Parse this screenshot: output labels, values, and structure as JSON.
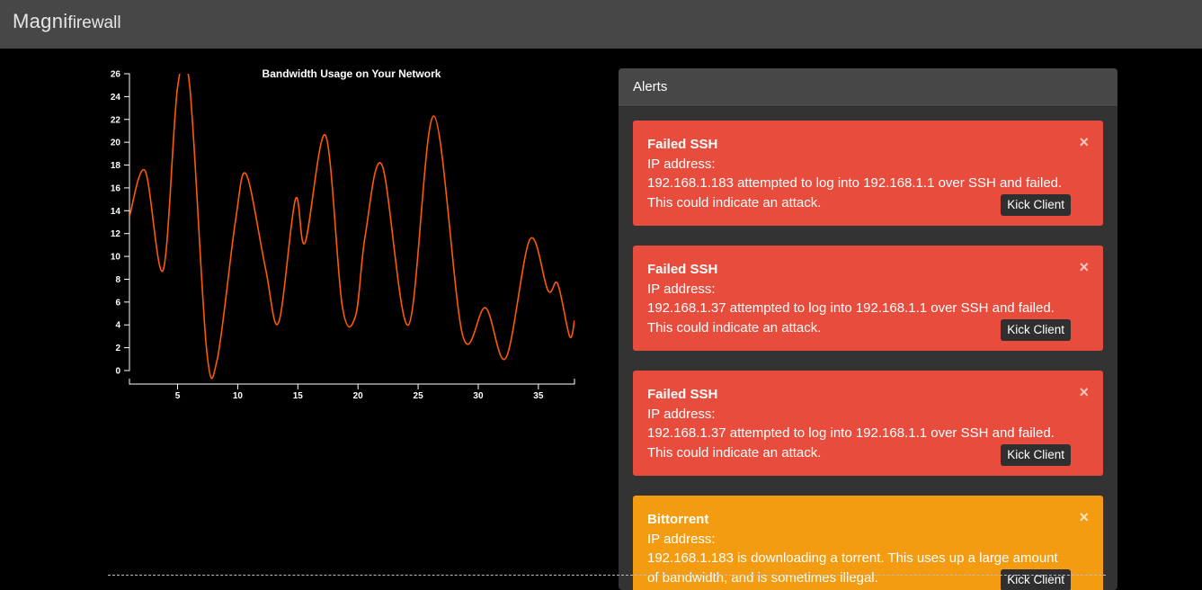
{
  "brand": {
    "part1": "Magni",
    "part2": "firewall"
  },
  "chart_data": {
    "type": "line",
    "title": "Bandwidth Usage on Your Network",
    "xlabel": "",
    "ylabel": "",
    "xlim": [
      1,
      38
    ],
    "ylim": [
      0,
      26
    ],
    "x_ticks": [
      5,
      10,
      15,
      20,
      25,
      30,
      35
    ],
    "y_ticks": [
      0,
      2,
      4,
      6,
      8,
      10,
      12,
      14,
      16,
      18,
      20,
      22,
      24,
      26
    ],
    "line_color": "#ff5a00",
    "series": [
      {
        "x": [
          1,
          2.3,
          3.8,
          5,
          6,
          7.4,
          8.3,
          9.8,
          10.7,
          12.3,
          13.4,
          14.8,
          15.6,
          17.3,
          18.7,
          19.8,
          20.6,
          22,
          24.2,
          26.3,
          28.7,
          30.6,
          32.3,
          34.3,
          35.8,
          36.6,
          37.6,
          38
        ],
        "y": [
          13.5,
          17.5,
          8.8,
          24.8,
          25,
          2,
          1,
          13,
          17.2,
          9,
          4.2,
          15,
          11.2,
          20.6,
          5.6,
          4.8,
          11.8,
          18,
          4,
          22.3,
          3.1,
          5.5,
          1.1,
          11.5,
          7,
          7.6,
          3,
          4.4
        ]
      }
    ]
  },
  "alerts": {
    "header": "Alerts",
    "close_glyph": "×",
    "items": [
      {
        "title": "Failed SSH",
        "ip_label": "IP address:",
        "message": "192.168.1.183 attempted to log into 192.168.1.1 over SSH and failed.",
        "note": "This could indicate an attack.",
        "action": "Kick Client",
        "color": "#e74c3c"
      },
      {
        "title": "Failed SSH",
        "ip_label": "IP address:",
        "message": "192.168.1.37 attempted to log into 192.168.1.1 over SSH and failed.",
        "note": "This could indicate an attack.",
        "action": "Kick Client",
        "color": "#e74c3c"
      },
      {
        "title": "Failed SSH",
        "ip_label": "IP address:",
        "message": "192.168.1.37 attempted to log into 192.168.1.1 over SSH and failed.",
        "note": "This could indicate an attack.",
        "action": "Kick Client",
        "color": "#e74c3c"
      },
      {
        "title": "Bittorrent",
        "ip_label": "IP address:",
        "message": "192.168.1.183 is downloading a torrent. This uses up a large amount",
        "note": "of bandwidth, and is sometimes illegal.",
        "action": "Kick Client",
        "color": "#f39c12"
      }
    ]
  }
}
